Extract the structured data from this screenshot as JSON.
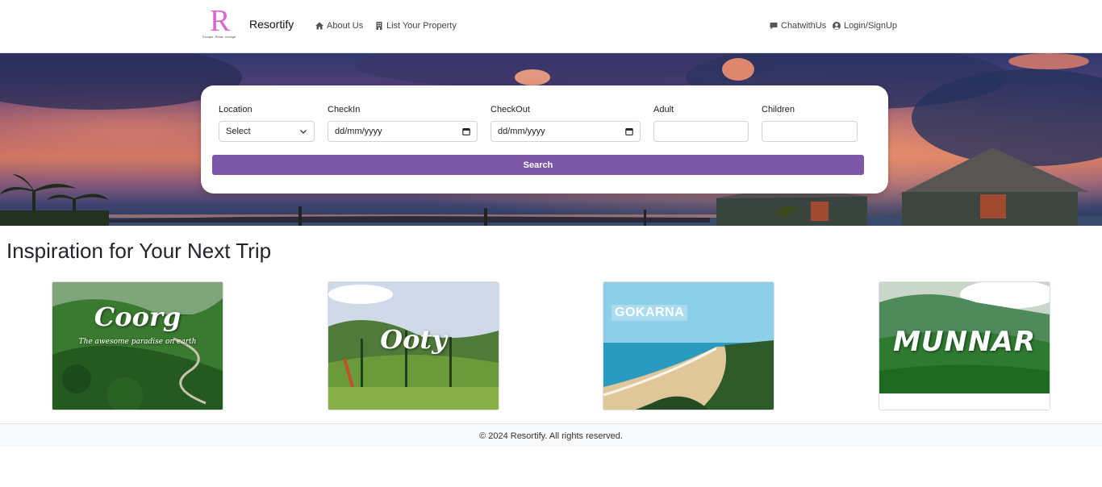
{
  "brand": {
    "logo_letter": "R",
    "logo_tagline": "Escape. Relax. Indulge.",
    "name": "Resortify"
  },
  "nav": {
    "about": "About Us",
    "list_property": "List Your Property",
    "chat": "ChatwithUs",
    "login": "Login/SignUp"
  },
  "search": {
    "location_label": "Location",
    "location_value": "Select",
    "checkin_label": "CheckIn",
    "checkin_value": "dd/mm/yyyy",
    "checkout_label": "CheckOut",
    "checkout_value": "dd/mm/yyyy",
    "adult_label": "Adult",
    "children_label": "Children",
    "button": "Search"
  },
  "inspiration": {
    "title": "Inspiration for Your Next Trip",
    "cards": [
      {
        "title": "Coorg",
        "subtitle": "The awesome paradise on earth"
      },
      {
        "title": "Ooty"
      },
      {
        "title": "GOKARNA"
      },
      {
        "title": "MUNNAR"
      }
    ]
  },
  "footer": {
    "text": "© 2024 Resortify. All rights reserved."
  },
  "colors": {
    "accent": "#7d57a8",
    "logo": "#d966d2"
  }
}
